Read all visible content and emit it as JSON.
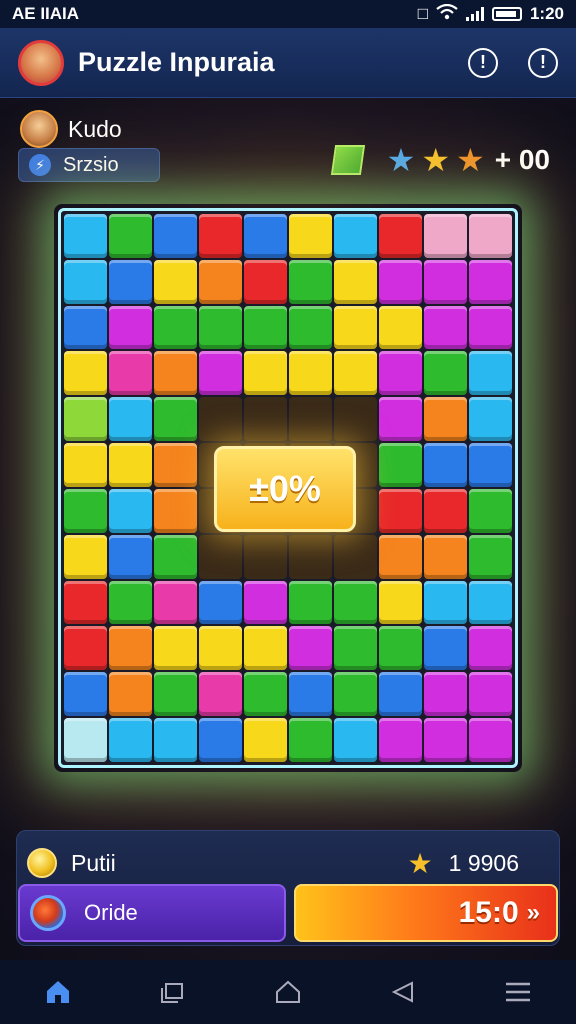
{
  "status_bar": {
    "left_text": "AE IIAIA",
    "time": "1:20"
  },
  "app_bar": {
    "title": "Puzzle Inpuraia"
  },
  "player": {
    "name": "Kudo"
  },
  "score_chip": {
    "label": "Srzsio"
  },
  "top_stats": {
    "value": "+ 00",
    "stars": [
      "blue",
      "gold",
      "orange"
    ]
  },
  "board": {
    "rows": 12,
    "cols": 10,
    "center_badge": "±0%",
    "colors": {
      "r": "#e8282a",
      "o": "#f5841e",
      "y": "#f8d81a",
      "g": "#2ebb2e",
      "b": "#2a7ae8",
      "c": "#2ab8f0",
      "m": "#d12ee0",
      "p": "#e83aa8",
      "l": "#8ed83a",
      "w": "#b8e8f0",
      "k": "#f0a8c8",
      "e": "#3a2a18"
    },
    "grid": [
      "cgbrbycrkk",
      "cbyorgymmm",
      "bmggggyymm",
      "ypomyyymgc",
      "lcgeeeemoc",
      "yyoeeeegbb",
      "gcoeeeerrg",
      "ybgeeeeoog",
      "rgpbmggycc",
      "royyymggbm",
      "bogpgbgbmm",
      "wccbygcmmm"
    ]
  },
  "bottom_panel": {
    "label": "Putii",
    "value": "1 9906",
    "left_button_label": "Oride",
    "right_button_label": "15:0"
  },
  "nav": {
    "items": [
      "home-icon",
      "recent-apps-icon",
      "home-outline-icon",
      "back-icon",
      "menu-icon"
    ]
  }
}
